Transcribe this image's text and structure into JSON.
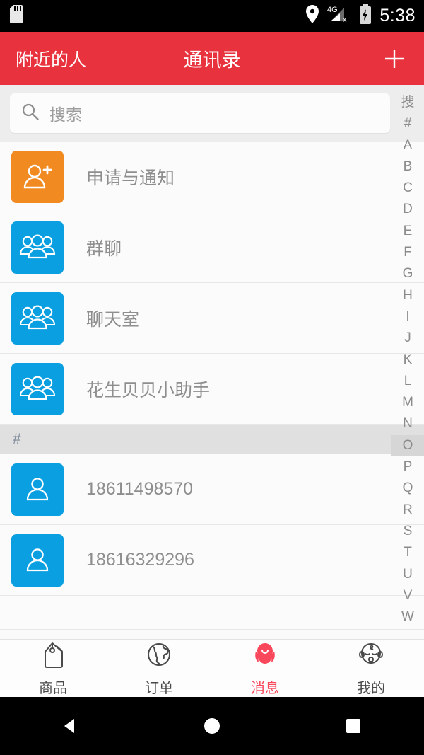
{
  "status_bar": {
    "time": "5:38",
    "icons": [
      "sd-card-icon",
      "location-icon",
      "signal-4g-no-service-icon",
      "battery-charging-icon"
    ]
  },
  "header": {
    "left_label": "附近的人",
    "title": "通讯录",
    "add_label": "+",
    "background": "#E8333F"
  },
  "search": {
    "placeholder": "搜索"
  },
  "list": {
    "items": [
      {
        "label": "申请与通知",
        "avatar": "person-add-icon",
        "avatar_color": "#F18A21"
      },
      {
        "label": "群聊",
        "avatar": "group-icon",
        "avatar_color": "#099FE1"
      },
      {
        "label": "聊天室",
        "avatar": "group-icon",
        "avatar_color": "#099FE1"
      },
      {
        "label": "花生贝贝小助手",
        "avatar": "group-icon",
        "avatar_color": "#099FE1"
      }
    ],
    "section_header": "#",
    "contacts": [
      {
        "label": "18611498570",
        "avatar": "person-icon",
        "avatar_color": "#099FE1"
      },
      {
        "label": "18616329296",
        "avatar": "person-icon",
        "avatar_color": "#099FE1"
      }
    ]
  },
  "alpha_index": {
    "letters": [
      "搜",
      "#",
      "A",
      "B",
      "C",
      "D",
      "E",
      "F",
      "G",
      "H",
      "I",
      "J",
      "K",
      "L",
      "M",
      "N",
      "O",
      "P",
      "Q",
      "R",
      "S",
      "T",
      "U",
      "V",
      "W"
    ],
    "highlighted": "O"
  },
  "tabs": [
    {
      "label": "商品",
      "icon": "price-tag-icon",
      "active": false
    },
    {
      "label": "订单",
      "icon": "globe-icon",
      "active": false
    },
    {
      "label": "消息",
      "icon": "peanut-character-icon",
      "active": true
    },
    {
      "label": "我的",
      "icon": "baby-face-icon",
      "active": false
    }
  ],
  "nav_bar": {
    "back": "back-triangle-icon",
    "home": "home-circle-icon",
    "recents": "recents-square-icon"
  },
  "colors": {
    "accent_red": "#E8333F",
    "active_red": "#F9485B",
    "blue": "#099FE1",
    "orange": "#F18A21"
  }
}
